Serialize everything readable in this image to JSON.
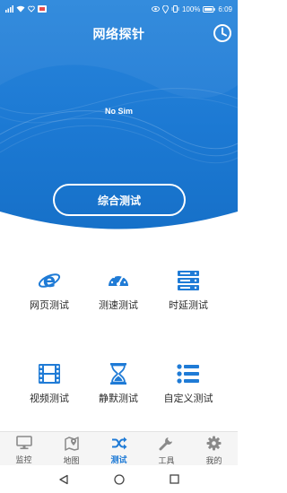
{
  "status_bar": {
    "battery": "100%",
    "time": "6:09"
  },
  "header": {
    "title": "网络探针"
  },
  "hero": {
    "sim_status": "No Sim",
    "main_button": "综合测试"
  },
  "tests": [
    {
      "label": "网页测试",
      "icon": "ie-icon"
    },
    {
      "label": "测速测试",
      "icon": "speedometer-icon"
    },
    {
      "label": "时延测试",
      "icon": "server-icon"
    },
    {
      "label": "视频测试",
      "icon": "film-icon"
    },
    {
      "label": "静默测试",
      "icon": "hourglass-icon"
    },
    {
      "label": "自定义测试",
      "icon": "list-icon"
    }
  ],
  "tabs": [
    {
      "label": "监控",
      "icon": "monitor-icon"
    },
    {
      "label": "地图",
      "icon": "map-icon"
    },
    {
      "label": "测试",
      "icon": "shuffle-icon",
      "active": true
    },
    {
      "label": "工具",
      "icon": "wrench-icon"
    },
    {
      "label": "我的",
      "icon": "gear-icon"
    }
  ],
  "colors": {
    "accent": "#1f7bd6",
    "hero": "#1c79d3",
    "tab_inactive": "#8a8a8a"
  }
}
